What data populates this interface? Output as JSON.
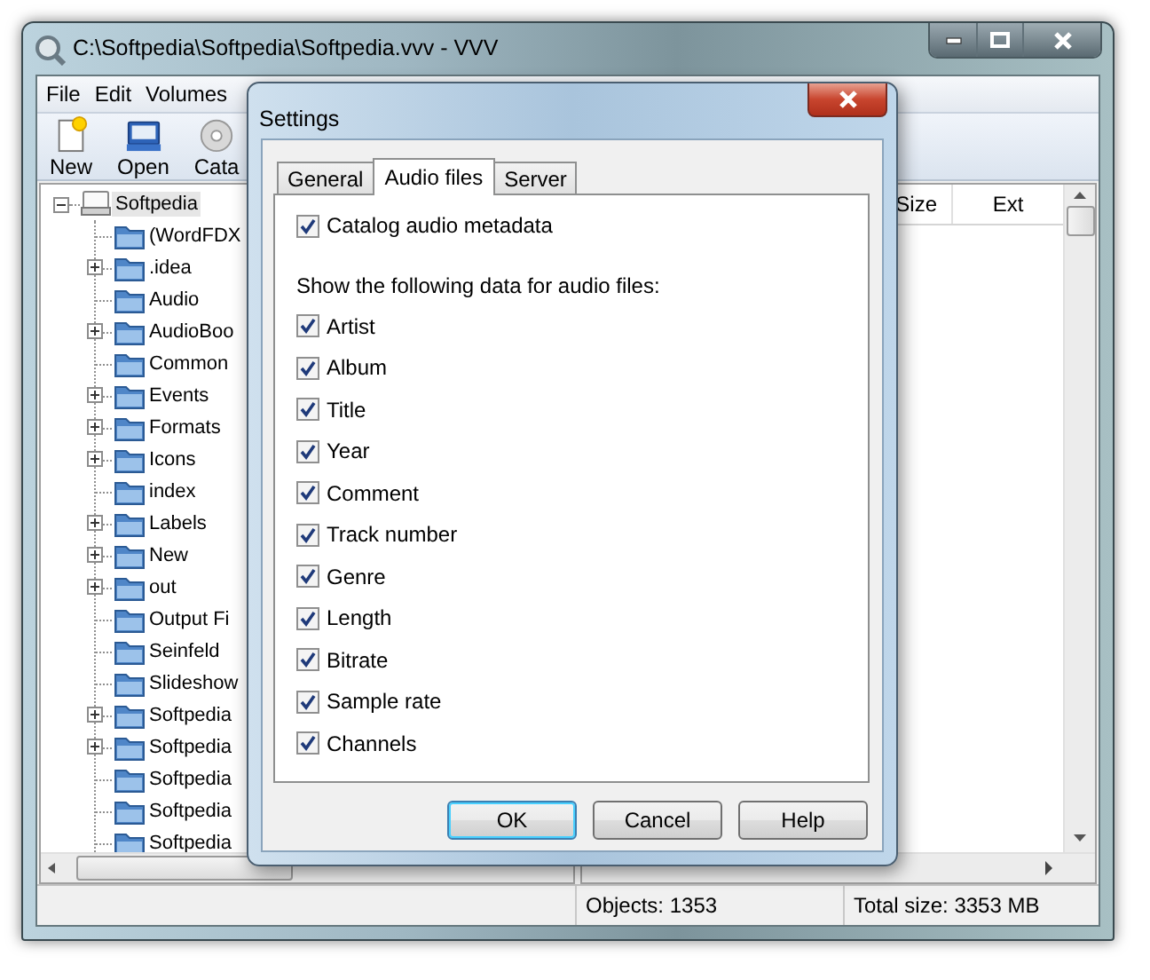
{
  "window": {
    "title": "C:\\Softpedia\\Softpedia\\Softpedia.vvv - VVV"
  },
  "menu": [
    "File",
    "Edit",
    "Volumes"
  ],
  "toolbar": [
    {
      "label": "New",
      "kind": "new"
    },
    {
      "label": "Open",
      "kind": "open"
    },
    {
      "label": "Cata",
      "kind": "disc"
    }
  ],
  "tree": {
    "label": "Softpedia",
    "expanded": true,
    "selected": true,
    "children": [
      {
        "label": "(WordFDX",
        "expandable": false,
        "selected": false
      },
      {
        "label": ".idea",
        "expandable": true,
        "selected": false
      },
      {
        "label": "Audio",
        "expandable": false,
        "selected": false
      },
      {
        "label": "AudioBoo",
        "expandable": true,
        "selected": false
      },
      {
        "label": "Common",
        "expandable": false,
        "selected": false
      },
      {
        "label": "Events",
        "expandable": true,
        "selected": false
      },
      {
        "label": "Formats",
        "expandable": true,
        "selected": false
      },
      {
        "label": "Icons",
        "expandable": true,
        "selected": false
      },
      {
        "label": "index",
        "expandable": false,
        "selected": false
      },
      {
        "label": "Labels",
        "expandable": true,
        "selected": false
      },
      {
        "label": "New",
        "expandable": true,
        "selected": false
      },
      {
        "label": "out",
        "expandable": true,
        "selected": false
      },
      {
        "label": "Output Fi",
        "expandable": false,
        "selected": false
      },
      {
        "label": "Seinfeld",
        "expandable": false,
        "selected": false
      },
      {
        "label": "Slideshow",
        "expandable": false,
        "selected": false
      },
      {
        "label": "Softpedia",
        "expandable": true,
        "selected": false
      },
      {
        "label": "Softpedia",
        "expandable": true,
        "selected": false
      },
      {
        "label": "Softpedia",
        "expandable": false,
        "selected": false
      },
      {
        "label": "Softpedia",
        "expandable": false,
        "selected": false
      },
      {
        "label": "Softpedia",
        "expandable": false,
        "selected": false
      }
    ]
  },
  "list": {
    "columns": [
      "Size",
      "Ext"
    ]
  },
  "status_bar": {
    "objects": "Objects: 1353",
    "total_size": "Total size: 3353 MB"
  },
  "dialog": {
    "title": "Settings",
    "tabs": [
      {
        "label": "General",
        "selected": false
      },
      {
        "label": "Audio files",
        "selected": true
      },
      {
        "label": "Server",
        "selected": false
      }
    ],
    "catalog": {
      "label": "Catalog audio metadata",
      "checked": true
    },
    "group_label": "Show the following data for audio files:",
    "fields": [
      {
        "label": "Artist",
        "checked": true
      },
      {
        "label": "Album",
        "checked": true
      },
      {
        "label": "Title",
        "checked": true
      },
      {
        "label": "Year",
        "checked": true
      },
      {
        "label": "Comment",
        "checked": true
      },
      {
        "label": "Track number",
        "checked": true
      },
      {
        "label": "Genre",
        "checked": true
      },
      {
        "label": "Length",
        "checked": true
      },
      {
        "label": "Bitrate",
        "checked": true
      },
      {
        "label": "Sample rate",
        "checked": true
      },
      {
        "label": "Channels",
        "checked": true
      }
    ],
    "buttons": [
      {
        "label": "OK",
        "default": true
      },
      {
        "label": "Cancel",
        "default": false
      },
      {
        "label": "Help",
        "default": false
      }
    ]
  }
}
